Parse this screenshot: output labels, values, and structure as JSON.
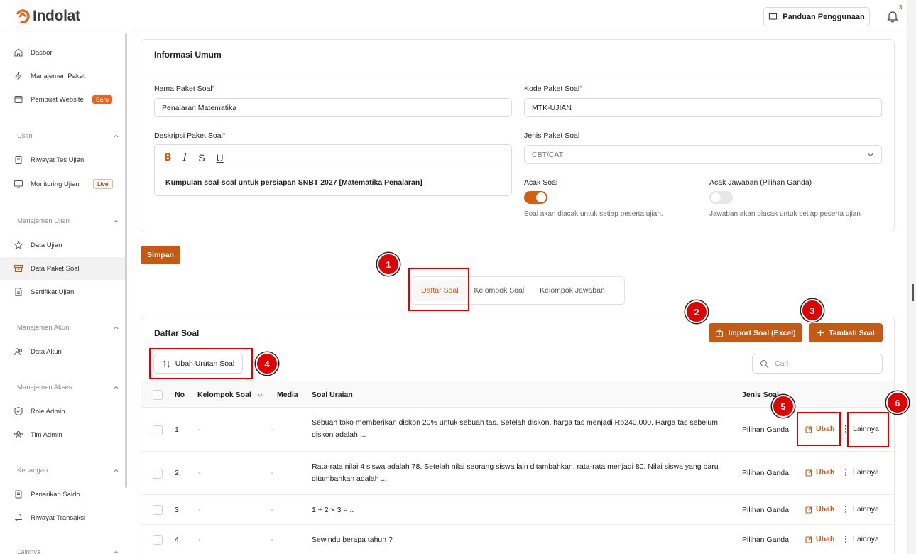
{
  "brand": {
    "name": "Indolat",
    "accent": "#c65a14"
  },
  "header": {
    "guide_label": "Panduan Penggunaan",
    "notif_count": "3"
  },
  "sidebar": {
    "items_top": [
      {
        "label": "Dasbor",
        "icon": "home-icon"
      },
      {
        "label": "Manajemen Paket",
        "icon": "bolt-icon"
      },
      {
        "label": "Pembuat Website",
        "icon": "browser-icon",
        "badge": "Baru"
      }
    ],
    "sections": [
      {
        "title": "Ujian",
        "items": [
          {
            "label": "Riwayat Tes Ujian",
            "icon": "clipboard-icon"
          },
          {
            "label": "Monitoring Ujian",
            "icon": "monitor-icon",
            "badge": "Live"
          }
        ]
      },
      {
        "title": "Manajemen Ujian",
        "items": [
          {
            "label": "Data Ujian",
            "icon": "star-icon"
          },
          {
            "label": "Data Paket Soal",
            "icon": "archive-icon",
            "active": true
          },
          {
            "label": "Sertifikat Ujian",
            "icon": "document-icon"
          }
        ]
      },
      {
        "title": "Manajemen Akun",
        "items": [
          {
            "label": "Data Akun",
            "icon": "users-icon"
          }
        ]
      },
      {
        "title": "Manajemen Akses",
        "items": [
          {
            "label": "Role Admin",
            "icon": "shield-check-icon"
          },
          {
            "label": "Tim Admin",
            "icon": "team-icon"
          }
        ]
      },
      {
        "title": "Keuangan",
        "items": [
          {
            "label": "Penarikan Saldo",
            "icon": "receipt-icon"
          },
          {
            "label": "Riwayat Transaksi",
            "icon": "transfer-icon"
          }
        ]
      }
    ],
    "cut_off_section": "Lainnya"
  },
  "info": {
    "title": "Informasi Umum",
    "name_label": "Nama Paket Soal",
    "name_value": "Penalaran Matematika",
    "code_label": "Kode Paket Soal",
    "code_value": "MTK-UJIAN",
    "desc_label": "Deskripsi Paket Soal",
    "desc_value": "Kumpulan soal-soal untuk persiapan SNBT 2027 [Matematika Penalaran]",
    "toolbar": {
      "bold": "B",
      "italic": "I",
      "strike": "S",
      "underline": "U"
    },
    "type_label": "Jenis Paket Soal",
    "type_value": "CBT/CAT",
    "shuffle_q_label": "Acak Soal",
    "shuffle_q_on": true,
    "shuffle_q_hint": "Soal akan diacak untuk setiap peserta ujian.",
    "shuffle_a_label": "Acak Jawaban (Pilihan Ganda)",
    "shuffle_a_on": false,
    "shuffle_a_hint": "Jawaban akan diacak untuk setiap peserta ujian",
    "required_mark": "*"
  },
  "save_label": "Simpan",
  "tabs": [
    "Daftar Soal",
    "Kelompok Soal",
    "Kelompok Jawaban"
  ],
  "list": {
    "title": "Daftar Soal",
    "import_label": "Import Soal (Excel)",
    "add_label": "Tambah Soal",
    "reorder_label": "Ubah Urutan Soal",
    "search_placeholder": "Cari",
    "columns": {
      "no": "No",
      "group": "Kelompok Soal",
      "media": "Media",
      "question": "Soal Uraian",
      "type": "Jenis Soal"
    },
    "edit_label": "Ubah",
    "more_label": "Lainnya",
    "rows": [
      {
        "no": "1",
        "group": "-",
        "media": "-",
        "question": "Sebuah toko memberikan diskon 20% untuk sebuah tas. Setelah diskon, harga tas menjadi Rp240.000. Harga tas sebelum diskon adalah ...",
        "type": "Pilihan Ganda"
      },
      {
        "no": "2",
        "group": "-",
        "media": "-",
        "question": "Rata-rata nilai 4 siswa adalah 78. Setelah nilai seorang siswa lain ditambahkan, rata-rata menjadi 80. Nilai siswa yang baru ditambahkan adalah ...",
        "type": "Pilihan Ganda"
      },
      {
        "no": "3",
        "group": "-",
        "media": "-",
        "question": "1 + 2 × 3 = ..",
        "type": "Pilihan Ganda"
      },
      {
        "no": "4",
        "group": "-",
        "media": "-",
        "question": "Sewindu berapa tahun ?",
        "type": "Pilihan Ganda"
      }
    ]
  },
  "markers": [
    "1",
    "2",
    "3",
    "4",
    "5",
    "6"
  ]
}
